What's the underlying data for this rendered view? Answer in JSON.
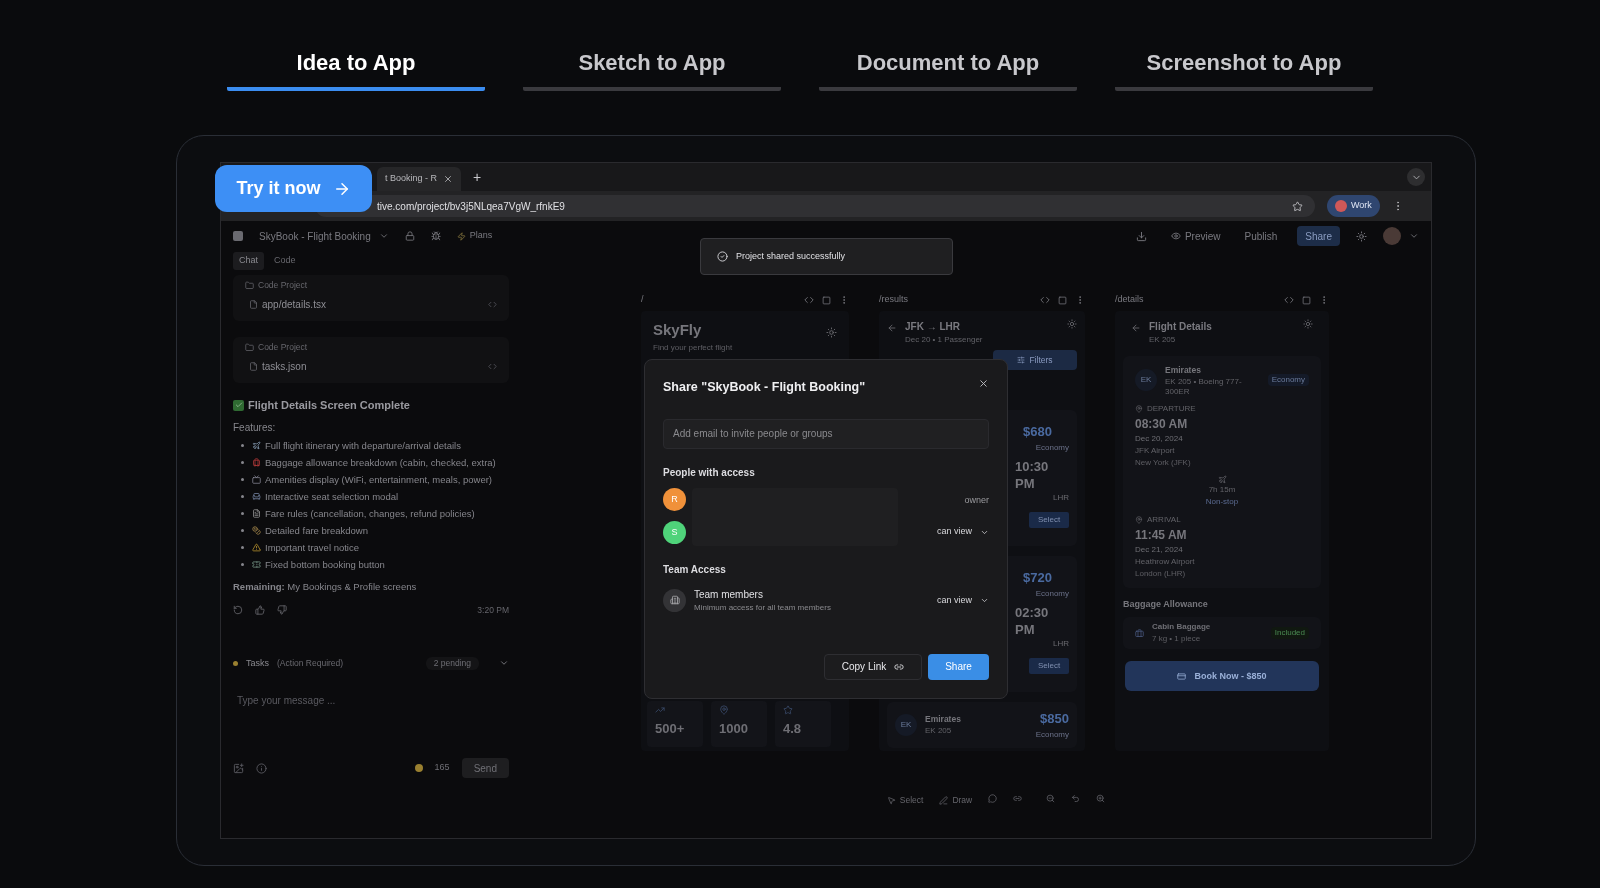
{
  "mode_tabs": [
    {
      "label": "Idea to App",
      "selected": true
    },
    {
      "label": "Sketch to App",
      "selected": false
    },
    {
      "label": "Document to App",
      "selected": false
    },
    {
      "label": "Screenshot to App",
      "selected": false
    }
  ],
  "try_button": {
    "label": "Try it now"
  },
  "browser": {
    "tab_title": "t Booking - R",
    "new_tab": "+",
    "url": "tive.com/project/bv3j5NLqea7VgW_rfnkE9",
    "profile": "Work"
  },
  "app_header": {
    "project": "SkyBook - Flight Booking",
    "plans": "Plans",
    "preview": "Preview",
    "publish": "Publish",
    "share": "Share"
  },
  "toast": {
    "message": "Project shared successfully"
  },
  "chat": {
    "tabs": [
      {
        "label": "Chat",
        "selected": true
      },
      {
        "label": "Code",
        "selected": false
      }
    ],
    "files": [
      {
        "project": "Code Project",
        "file": "app/details.tsx"
      },
      {
        "project": "Code Project",
        "file": "tasks.json"
      }
    ],
    "title": "Flight Details Screen Complete",
    "features_label": "Features:",
    "features": [
      "Full flight itinerary with departure/arrival details",
      "Baggage allowance breakdown (cabin, checked, extra)",
      "Amenities display (WiFi, entertainment, meals, power)",
      "Interactive seat selection modal",
      "Fare rules (cancellation, changes, refund policies)",
      "Detailed fare breakdown",
      "Important travel notice",
      "Fixed bottom booking button"
    ],
    "remaining": "**Remaining:** My Bookings & Profile screens",
    "time": "3:20 PM",
    "tasks": {
      "label": "Tasks",
      "note": "(Action Required)",
      "count": "2 pending"
    },
    "input": {
      "placeholder": "Type your message ..."
    },
    "credits": "165",
    "send": "Send"
  },
  "home_frame": {
    "path": "/",
    "title": "SkyFly",
    "subtitle": "Find your perfect flight",
    "stats": [
      "500+",
      "1000",
      "4.8"
    ]
  },
  "results_frame": {
    "path": "/results",
    "route": "JFK → LHR",
    "subtitle": "Dec 20 • 1 Passenger",
    "filters": "Filters",
    "flights": [
      {
        "price": "$680",
        "cabin": "Economy",
        "time": "10:30 PM",
        "airport": "LHR",
        "select": "Select"
      },
      {
        "price": "$720",
        "cabin": "Economy",
        "time": "02:30 PM",
        "airport": "LHR",
        "select": "Select"
      }
    ],
    "last_flight": {
      "badge": "EK",
      "airline": "Emirates",
      "code": "EK 205",
      "price": "$850",
      "cabin": "Economy"
    }
  },
  "details_frame": {
    "path": "/details",
    "title": "Flight Details",
    "subtitle": "EK 205",
    "badge": "EK",
    "airline": "Emirates",
    "aircraft": "EK 205 • Boeing 777-300ER",
    "cabin": "Economy",
    "departure": {
      "label": "DEPARTURE",
      "time": "08:30 AM",
      "date": "Dec 20, 2024",
      "airport": "JFK Airport",
      "city": "New York (JFK)"
    },
    "duration": "7h 15m",
    "stops": "Non-stop",
    "arrival": {
      "label": "ARRIVAL",
      "time": "11:45 AM",
      "date": "Dec 21, 2024",
      "airport": "Heathrow Airport",
      "city": "London (LHR)"
    },
    "baggage_title": "Baggage Allowance",
    "baggage": {
      "name": "Cabin Baggage",
      "detail": "7 kg • 1 piece",
      "status": "Included"
    },
    "book": "Book Now - $850"
  },
  "canvas_toolbar": {
    "select": "Select",
    "draw": "Draw"
  },
  "share_dialog": {
    "title": "Share \"SkyBook - Flight Booking\"",
    "placeholder": "Add email to invite people or groups",
    "people_heading": "People with access",
    "people": [
      {
        "initial": "R",
        "color": "#f0913a",
        "role": "owner",
        "dropdown": false
      },
      {
        "initial": "S",
        "color": "#4fd37a",
        "role": "can view",
        "dropdown": true
      }
    ],
    "team_heading": "Team Access",
    "team": {
      "name": "Team members",
      "description": "Minimum access for all team members",
      "role": "can view"
    },
    "copy_link": "Copy Link",
    "share": "Share"
  }
}
